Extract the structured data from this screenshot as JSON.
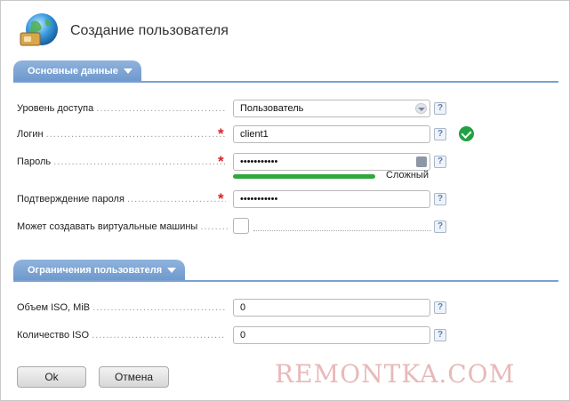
{
  "page": {
    "title": "Создание пользователя"
  },
  "sections": {
    "main": {
      "label": "Основные данные"
    },
    "limits": {
      "label": "Ограничения пользователя"
    }
  },
  "fields": {
    "access_level": {
      "label": "Уровень доступа",
      "value": "Пользователь"
    },
    "login": {
      "label": "Логин",
      "value": "client1",
      "required_mark": "*"
    },
    "password": {
      "label": "Пароль",
      "value": "•••••••••••",
      "required_mark": "*",
      "strength_text": "Сложный",
      "strength_fraction": 1.0
    },
    "password_confirm": {
      "label": "Подтверждение пароля",
      "value": "•••••••••••",
      "required_mark": "*"
    },
    "can_create_vm": {
      "label": "Может создавать виртуальные машины",
      "checked": false
    },
    "iso_size": {
      "label": "Объем ISO, MiB",
      "value": "0"
    },
    "iso_count": {
      "label": "Количество ISO",
      "value": "0"
    }
  },
  "help_glyph": "?",
  "buttons": {
    "ok": "Ok",
    "cancel": "Отмена"
  },
  "watermark": "REMONTKA.COM",
  "icons": {
    "header": "globe-user-icon",
    "ok_status": "check-circle-icon",
    "help": "help-icon",
    "keyboard": "keyboard-icon"
  },
  "colors": {
    "section_tab": "#7aa0d2",
    "required": "#d9262a",
    "success": "#22a045",
    "strength": "#2fa83e"
  }
}
